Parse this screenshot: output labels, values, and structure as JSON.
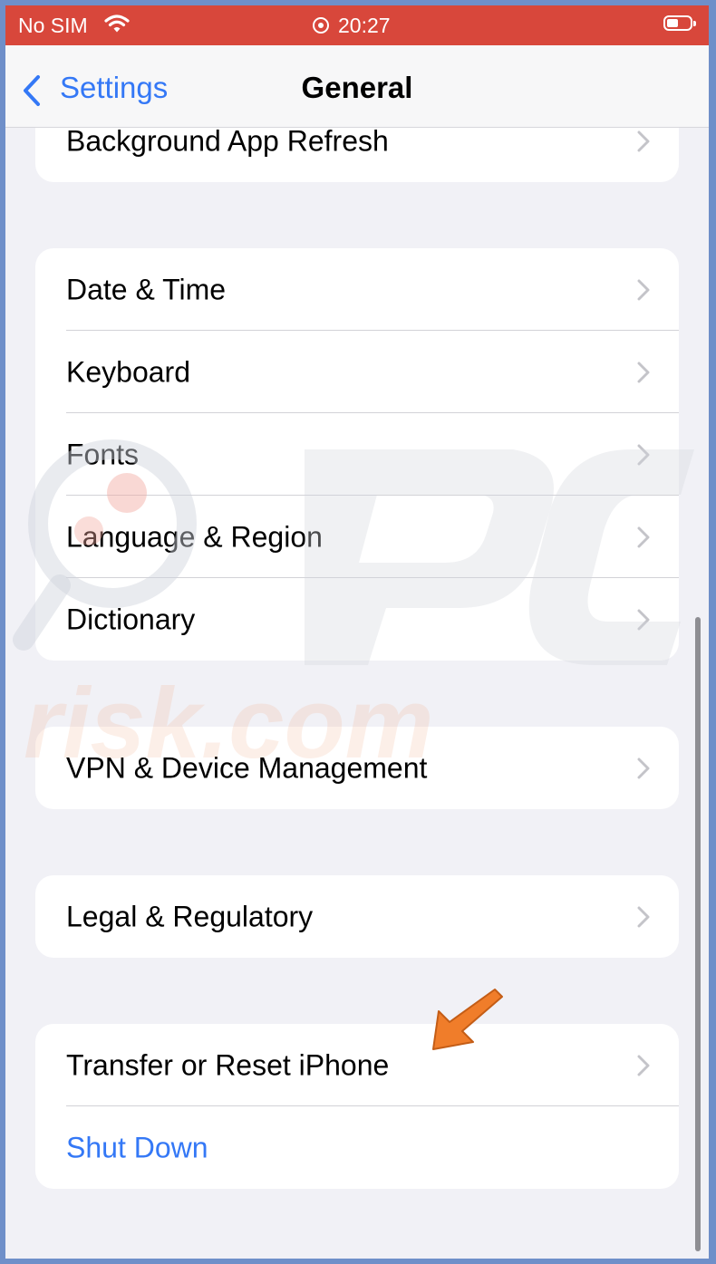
{
  "status_bar": {
    "carrier": "No SIM",
    "time": "20:27",
    "wifi_icon": "wifi-icon",
    "battery_icon": "battery-icon",
    "background_color": "#d8473b"
  },
  "nav": {
    "back_label": "Settings",
    "title": "General",
    "accent_color": "#3478f6"
  },
  "groups": [
    {
      "rows": [
        {
          "label": "Background App Refresh"
        }
      ]
    },
    {
      "rows": [
        {
          "label": "Date & Time"
        },
        {
          "label": "Keyboard"
        },
        {
          "label": "Fonts"
        },
        {
          "label": "Language & Region"
        },
        {
          "label": "Dictionary"
        }
      ]
    },
    {
      "rows": [
        {
          "label": "VPN & Device Management"
        }
      ]
    },
    {
      "rows": [
        {
          "label": "Legal & Regulatory"
        }
      ]
    },
    {
      "rows": [
        {
          "label": "Transfer or Reset iPhone"
        },
        {
          "label": "Shut Down"
        }
      ]
    }
  ],
  "watermark": {
    "text": "PCrisk.com"
  }
}
